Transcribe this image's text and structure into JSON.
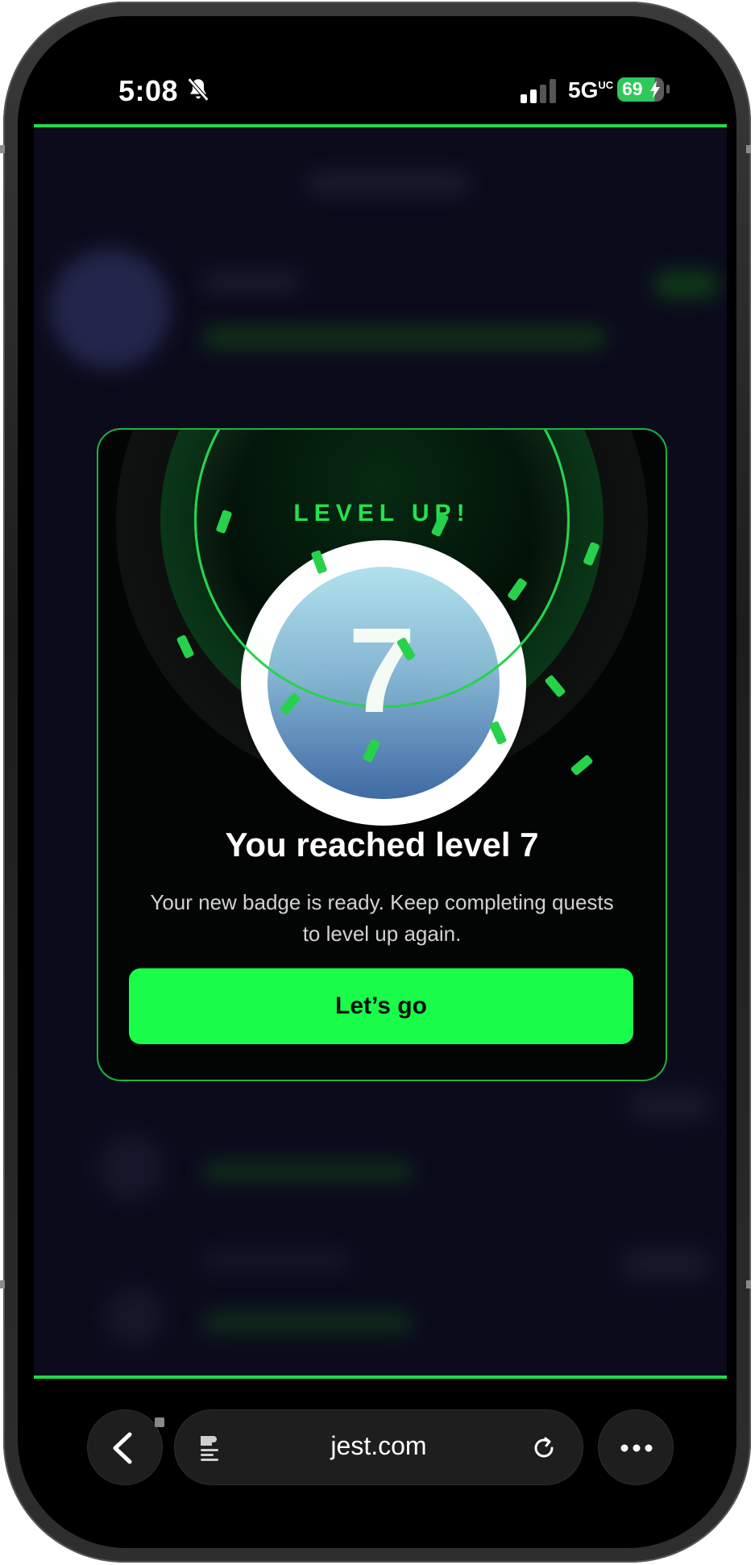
{
  "status_bar": {
    "time": "5:08",
    "network": "5G",
    "network_sup": "UC",
    "battery": "69"
  },
  "modal": {
    "heading": "LEVEL UP!",
    "level_number": "7",
    "title": "You reached level 7",
    "subtitle": "Your new badge is ready. Keep completing quests to level up again.",
    "cta_label": "Let’s go"
  },
  "browser": {
    "url": "jest.com"
  },
  "colors": {
    "accent": "#19fd4a",
    "background": "#0b0b1c",
    "card": "#030504"
  }
}
